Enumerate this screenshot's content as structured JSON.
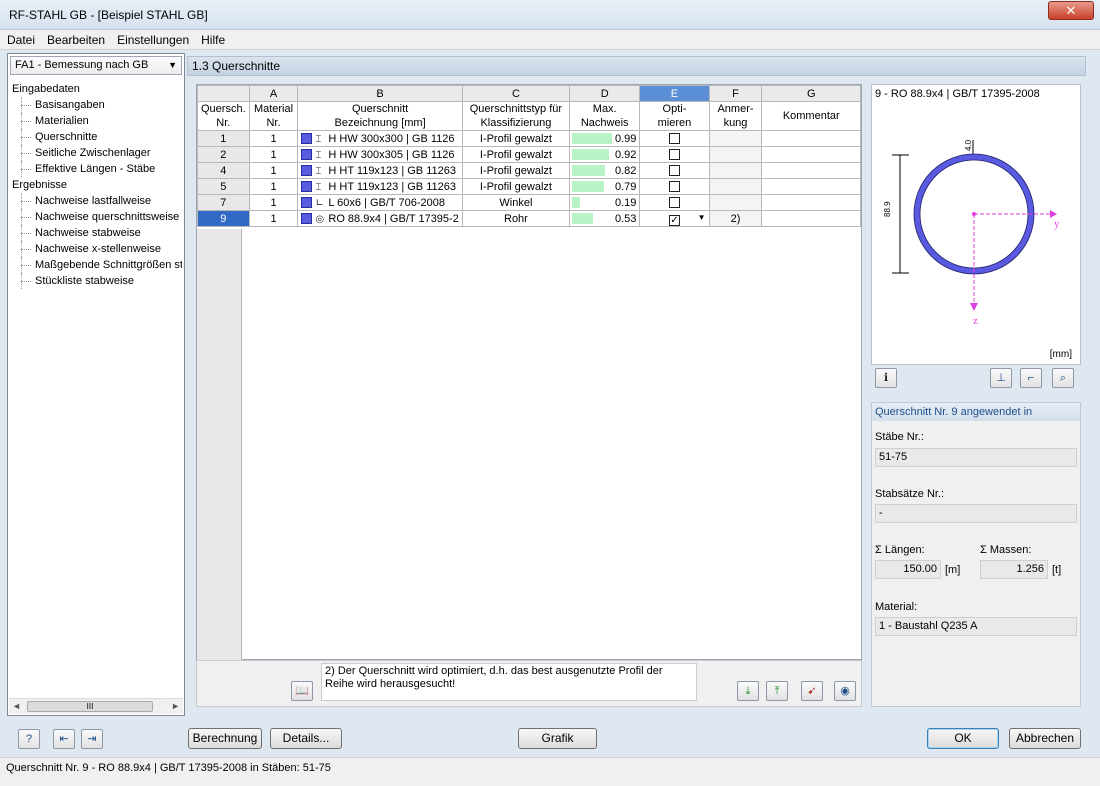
{
  "window": {
    "title": "RF-STAHL GB - [Beispiel STAHL GB]",
    "close": "✕"
  },
  "menu": [
    "Datei",
    "Bearbeiten",
    "Einstellungen",
    "Hilfe"
  ],
  "module_select": {
    "value": "FA1 - Bemessung nach GB",
    "arrow": "▼"
  },
  "tree": {
    "input_group": "Eingabedaten",
    "input_items": [
      "Basisangaben",
      "Materialien",
      "Querschnitte",
      "Seitliche Zwischenlager",
      "Effektive Längen - Stäbe"
    ],
    "results_group": "Ergebnisse",
    "results_items": [
      "Nachweise lastfallweise",
      "Nachweise querschnittsweise",
      "Nachweise stabweise",
      "Nachweise x-stellenweise",
      "Maßgebende Schnittgrößen sta",
      "Stückliste stabweise"
    ],
    "scroll_left": "◄",
    "scroll_right": "►",
    "scroll_thumb": "III"
  },
  "section_title": "1.3 Querschnitte",
  "table": {
    "letters": [
      "A",
      "B",
      "C",
      "D",
      "E",
      "F",
      "G"
    ],
    "headers": {
      "num1": "Quersch.",
      "num2": "Nr.",
      "a1": "Material",
      "a2": "Nr.",
      "b1": "Querschnitt",
      "b2": "Bezeichnung [mm]",
      "c1": "Querschnittstyp für",
      "c2": "Klassifizierung",
      "d1": "Max.",
      "d2": "Nachweis",
      "e1": "Opti-",
      "e2": "mieren",
      "f1": "Anmer-",
      "f2": "kung",
      "g1": "",
      "g2": "Kommentar"
    },
    "rows": [
      {
        "nr": "1",
        "mat": "1",
        "sym": "⌶",
        "name": "H HW 300x300 | GB 1126",
        "type": "I-Profil gewalzt",
        "max": "0.99",
        "ratio": 0.99,
        "opt": "",
        "note": "",
        "comment": ""
      },
      {
        "nr": "2",
        "mat": "1",
        "sym": "⌶",
        "name": "H HW 300x305 | GB 1126",
        "type": "I-Profil gewalzt",
        "max": "0.92",
        "ratio": 0.92,
        "opt": "",
        "note": "",
        "comment": ""
      },
      {
        "nr": "4",
        "mat": "1",
        "sym": "⌶",
        "name": "H HT 119x123 | GB 11263",
        "type": "I-Profil gewalzt",
        "max": "0.82",
        "ratio": 0.82,
        "opt": "",
        "note": "",
        "comment": ""
      },
      {
        "nr": "5",
        "mat": "1",
        "sym": "⌶",
        "name": "H HT 119x123 | GB 11263",
        "type": "I-Profil gewalzt",
        "max": "0.79",
        "ratio": 0.79,
        "opt": "",
        "note": "",
        "comment": ""
      },
      {
        "nr": "7",
        "mat": "1",
        "sym": "∟",
        "name": "L 60x6 | GB/T 706-2008",
        "type": "Winkel",
        "max": "0.19",
        "ratio": 0.19,
        "opt": "",
        "note": "",
        "comment": ""
      },
      {
        "nr": "9",
        "mat": "1",
        "sym": "◎",
        "name": "RO 88.9x4 | GB/T 17395-2",
        "type": "Rohr",
        "max": "0.53",
        "ratio": 0.53,
        "opt": "✓",
        "note": "2)",
        "comment": ""
      }
    ]
  },
  "note": "2) Der Querschnitt wird optimiert, d.h. das best ausgenutzte Profil der Reihe wird herausgesucht!",
  "preview": {
    "title": "9 - RO 88.9x4 | GB/T 17395-2008",
    "dim_t": "4.0",
    "dim_d": "88.9",
    "axis_y": "y",
    "axis_z": "z",
    "unit": "[mm]"
  },
  "info": {
    "header": "Querschnitt Nr. 9 angewendet in",
    "members_label": "Stäbe Nr.:",
    "members_value": "51-75",
    "sets_label": "Stabsätze Nr.:",
    "sets_value": "-",
    "lengths_label": "Σ Längen:",
    "lengths_value": "150.00",
    "lengths_unit": "[m]",
    "masses_label": "Σ Massen:",
    "masses_value": "1.256",
    "masses_unit": "[t]",
    "material_label": "Material:",
    "material_value": "1 - Baustahl Q235 A"
  },
  "buttons": {
    "berechnung": "Berechnung",
    "details": "Details...",
    "grafik": "Grafik",
    "ok": "OK",
    "abbrechen": "Abbrechen"
  },
  "status": "Querschnitt Nr. 9 - RO 88.9x4 | GB/T 17395-2008 in Stäben: 51-75",
  "colors": {
    "accent": "#316ac5",
    "section": "#5a5ae0",
    "axis": "#e040e0",
    "ratio_bar": "#b8f2c6"
  }
}
